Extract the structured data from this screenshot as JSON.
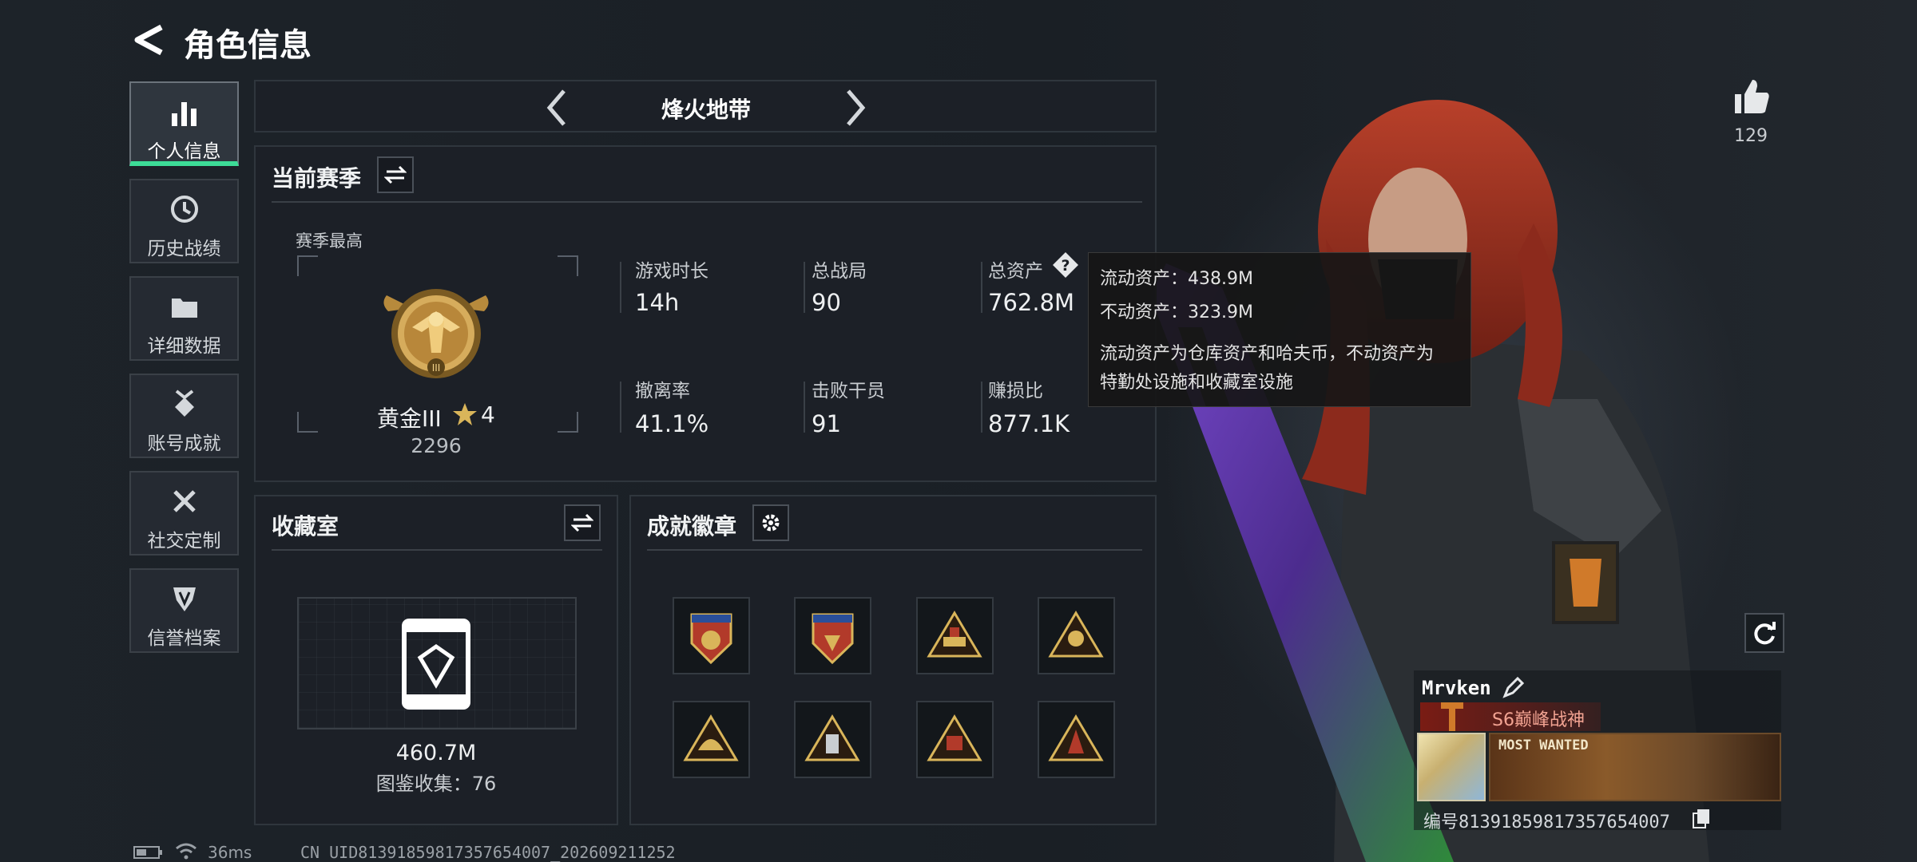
{
  "header": {
    "title": "角色信息"
  },
  "sidebar": {
    "items": [
      {
        "label": "个人信息",
        "icon": "bar-chart-icon",
        "active": true
      },
      {
        "label": "历史战绩",
        "icon": "clock-icon"
      },
      {
        "label": "详细数据",
        "icon": "folder-icon"
      },
      {
        "label": "账号成就",
        "icon": "medal-icon"
      },
      {
        "label": "社交定制",
        "icon": "tools-icon"
      },
      {
        "label": "信誉档案",
        "icon": "shield-icon"
      }
    ]
  },
  "mode_selector": {
    "label": "烽火地带"
  },
  "season": {
    "title": "当前赛季",
    "best_label": "赛季最高",
    "rank_name": "黄金III",
    "rank_stars": "4",
    "rank_score": "2296",
    "stats": [
      {
        "label": "游戏时长",
        "value": "14h"
      },
      {
        "label": "总战局",
        "value": "90"
      },
      {
        "label": "总资产",
        "value": "762.8M"
      },
      {
        "label": "撤离率",
        "value": "41.1%"
      },
      {
        "label": "击败干员",
        "value": "91"
      },
      {
        "label": "赚损比",
        "value": "877.1K"
      }
    ]
  },
  "tooltip": {
    "line1": "流动资产：438.9M",
    "line2": "不动资产：323.9M",
    "desc1": "流动资产为仓库资产和哈夫币，不动资产为",
    "desc2": "特勤处设施和收藏室设施"
  },
  "collection": {
    "title": "收藏室",
    "value": "460.7M",
    "count_text": "图鉴收集：76"
  },
  "achievements": {
    "title": "成就徽章",
    "badge_count": 8
  },
  "likes": {
    "count": "129"
  },
  "player": {
    "name": "Mrvken",
    "title_text": "S6巅峰战神",
    "card_text": "MOST WANTED",
    "id_text": "编号81391859817357654007"
  },
  "status_bar": {
    "ping": "36ms",
    "uid_text": "CN UID81391859817357654007_202609211252"
  },
  "colors": {
    "accent": "#3ddc97",
    "gold": "#c9a050",
    "badge_red": "#b23a2a"
  }
}
